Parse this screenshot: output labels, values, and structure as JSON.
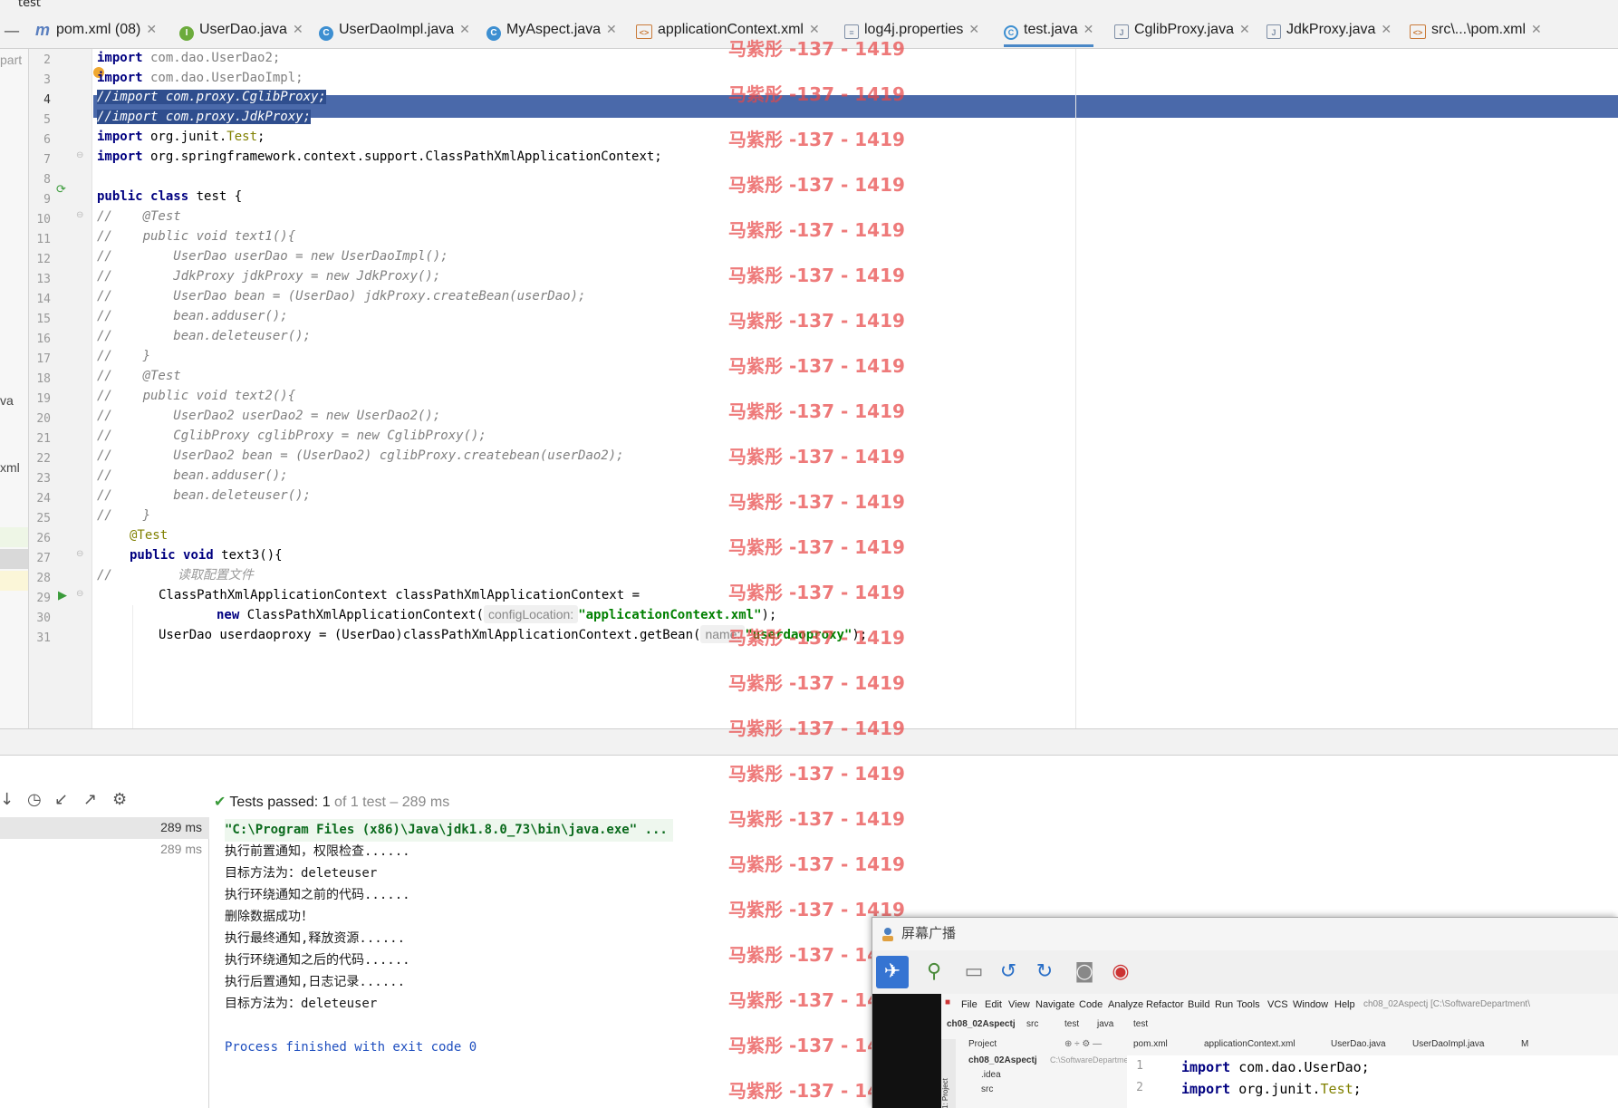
{
  "window": {
    "title": "test"
  },
  "tabs": [
    {
      "label": "pom.xml (08)",
      "icon": "maven-icon",
      "active": false
    },
    {
      "label": "UserDao.java",
      "icon": "interface-icon",
      "active": false
    },
    {
      "label": "UserDaoImpl.java",
      "icon": "class-icon",
      "active": false
    },
    {
      "label": "MyAspect.java",
      "icon": "class-icon",
      "active": false
    },
    {
      "label": "applicationContext.xml",
      "icon": "xml-file-icon",
      "active": false
    },
    {
      "label": "log4j.properties",
      "icon": "properties-file-icon",
      "active": false
    },
    {
      "label": "test.java",
      "icon": "test-class-icon",
      "active": true
    },
    {
      "label": "CglibProxy.java",
      "icon": "java-file-icon",
      "active": false
    },
    {
      "label": "JdkProxy.java",
      "icon": "java-file-icon",
      "active": false
    },
    {
      "label": "src\\...\\pom.xml",
      "icon": "xml-file-icon",
      "active": false
    }
  ],
  "project_fragments": {
    "part": "part",
    "va": "va",
    "xml": "xml"
  },
  "line_numbers": [
    "2",
    "3",
    "4",
    "5",
    "6",
    "7",
    "8",
    "9",
    "10",
    "11",
    "12",
    "13",
    "14",
    "15",
    "16",
    "17",
    "18",
    "19",
    "20",
    "21",
    "22",
    "23",
    "24",
    "25",
    "26",
    "27",
    "28",
    "29",
    "30",
    "31"
  ],
  "code": {
    "l2": {
      "kw": "import",
      "rest": " com.dao.UserDao2;"
    },
    "l3": {
      "kw": "import",
      "rest": " com.dao.UserDaoImpl;"
    },
    "l4": {
      "a": "//",
      "b": "import com.proxy.CglibProxy;"
    },
    "l5": {
      "a": "//import com.proxy.JdkProxy;"
    },
    "l6": {
      "kw": "import",
      "rest": " org.junit.",
      "ann": "Test",
      "end": ";"
    },
    "l7": {
      "kw": "import",
      "rest": " org.springframework.context.support.ClassPathXmlApplicationContext;"
    },
    "l9": {
      "kw1": "public",
      "kw2": "class",
      "rest": " test {"
    },
    "l10": "//    @Test",
    "l11": "//    public void text1(){",
    "l12": "//        UserDao userDao = new UserDaoImpl();",
    "l13": "//        JdkProxy jdkProxy = new JdkProxy();",
    "l14": "//        UserDao bean = (UserDao) jdkProxy.createBean(userDao);",
    "l15": "//        bean.adduser();",
    "l16": "//        bean.deleteuser();",
    "l17": "//    }",
    "l18": "//    @Test",
    "l19": "//    public void text2(){",
    "l20": "//        UserDao2 userDao2 = new UserDao2();",
    "l21": "//        CglibProxy cglibProxy = new CglibProxy();",
    "l22": "//        UserDao2 bean = (UserDao2) cglibProxy.createbean(userDao2);",
    "l23": "//        bean.adduser();",
    "l24": "//        bean.deleteuser();",
    "l25": "//    }",
    "l26": "@Test",
    "l27": {
      "kw1": "public",
      "kw2": "void",
      "rest": " text3(){"
    },
    "l28": {
      "a": "//",
      "b": "读取配置文件"
    },
    "l29": "ClassPathXmlApplicationContext classPathXmlApplicationContext =",
    "l30": {
      "kw": "new",
      "rest": " ClassPathXmlApplicationContext(",
      "hint": "configLocation:",
      "str": "\"applicationContext.xml\"",
      "end": ");"
    },
    "l31": {
      "rest": "UserDao userdaoproxy = (UserDao)classPathXmlApplicationContext.getBean(",
      "hint": "name:",
      "str": "\"userdaoproxy\"",
      "end": ");"
    }
  },
  "run": {
    "status_label": "Tests passed:",
    "status_count": "1",
    "status_rest": "of 1 test – 289 ms",
    "tree_times": [
      "289 ms",
      "289 ms"
    ],
    "console": [
      "\"C:\\Program Files (x86)\\Java\\jdk1.8.0_73\\bin\\java.exe\" ...",
      "执行前置通知，权限检查......",
      "目标方法为：deleteuser",
      "执行环绕通知之前的代码......",
      "删除数据成功！",
      "执行最终通知,释放资源......",
      "执行环绕通知之后的代码......",
      "执行后置通知,日志记录......",
      "目标方法为：deleteuser",
      "",
      "Process finished with exit code 0"
    ]
  },
  "watermark": "马紫彤 -137 - 1419",
  "broadcast": {
    "title": "屏幕广播",
    "menu": [
      "File",
      "Edit",
      "View",
      "Navigate",
      "Code",
      "Analyze",
      "Refactor",
      "Build",
      "Run",
      "Tools",
      "VCS",
      "Window",
      "Help"
    ],
    "project_title": "ch08_02Aspectj [C:\\SoftwareDepartment\\",
    "breadcrumb": [
      "ch08_02Aspectj",
      "src",
      "test",
      "java",
      "test"
    ],
    "panel_label": "Project",
    "side_label": "1: Project",
    "tree": [
      "ch08_02Aspectj",
      "C:\\SoftwareDepartme",
      ".idea",
      "src"
    ],
    "tabs": [
      "pom.xml",
      "applicationContext.xml",
      "UserDao.java",
      "UserDaoImpl.java",
      "M"
    ],
    "code": [
      {
        "n": "1",
        "kw": "import",
        "rest": " com.dao.UserDao;"
      },
      {
        "n": "2",
        "kw": "import",
        "rest": " org.junit.",
        "ann": "Test",
        "end": ";"
      }
    ]
  },
  "colors": {
    "selection": "#4a69aa",
    "keyword": "#000080",
    "string": "#008000",
    "annotation": "#808000",
    "watermark": "#e84646"
  }
}
